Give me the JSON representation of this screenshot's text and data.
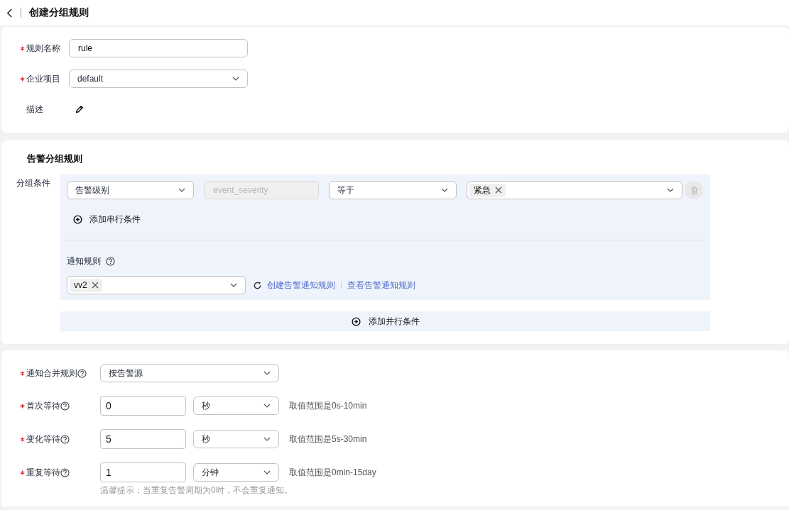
{
  "header": {
    "title": "创建分组规则"
  },
  "basic": {
    "fields": [
      {
        "kind": "input",
        "label": "规则名称",
        "required": true,
        "value": "rule"
      },
      {
        "kind": "select",
        "label": "企业项目",
        "required": true,
        "value": "default"
      },
      {
        "kind": "edit",
        "label": "描述",
        "required": false
      }
    ]
  },
  "grouping": {
    "title": "告警分组规则",
    "condition_label": "分组条件",
    "conditions": [
      {
        "field": "告警级别",
        "key": "event_severity",
        "key_disabled": true,
        "operator": "等于",
        "tags": [
          "紧急"
        ]
      }
    ],
    "add_serial": "添加串行条件",
    "notify_label": "通知规则",
    "notify_tags": [
      "vv2"
    ],
    "links": [
      "创建告警通知规则",
      "查看告警通知规则"
    ],
    "add_parallel": "添加并行条件"
  },
  "timing": {
    "rows": [
      {
        "kind": "select",
        "label": "通知合并规则",
        "required": true,
        "help": true,
        "value": "按告警源"
      },
      {
        "kind": "number",
        "label": "首次等待",
        "required": true,
        "help": true,
        "value": "0",
        "unit": "秒",
        "range": "取值范围是0s-10min"
      },
      {
        "kind": "number",
        "label": "变化等待",
        "required": true,
        "help": true,
        "value": "5",
        "unit": "秒",
        "range": "取值范围是5s-30min"
      },
      {
        "kind": "number",
        "label": "重复等待",
        "required": true,
        "help": true,
        "value": "1",
        "unit": "分钟",
        "range": "取值范围是0min-15day"
      }
    ],
    "hint": "温馨提示：当重复告警周期为0时，不会重复通知。"
  }
}
